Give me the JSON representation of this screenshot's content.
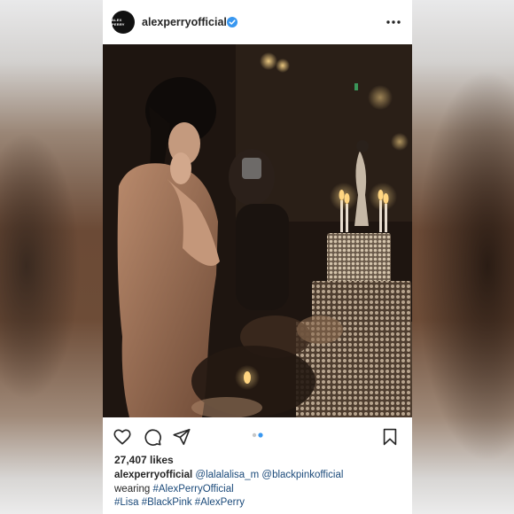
{
  "post": {
    "avatar_text": "ALEX PERRY",
    "username": "alexperryofficial",
    "likes": "27,407 likes",
    "caption": {
      "username": "alexperryofficial",
      "mention1": "@lalalalisa_m",
      "mention2": "@blackpinkofficial",
      "text": "wearing",
      "tag1": "#AlexPerryOfficial",
      "tag2": "#Lisa",
      "tag3": "#BlackPink",
      "tag4": "#AlexPerry"
    },
    "carousel": {
      "count": 2,
      "active": 2
    }
  },
  "icons": {
    "verified": "verified-badge-icon",
    "more": "more-options-icon",
    "like": "heart-icon",
    "comment": "comment-icon",
    "share": "share-icon",
    "save": "bookmark-icon"
  },
  "colors": {
    "verified": "#3897f0",
    "active_dot": "#3897f0",
    "hashtag": "#1b4a7a"
  }
}
